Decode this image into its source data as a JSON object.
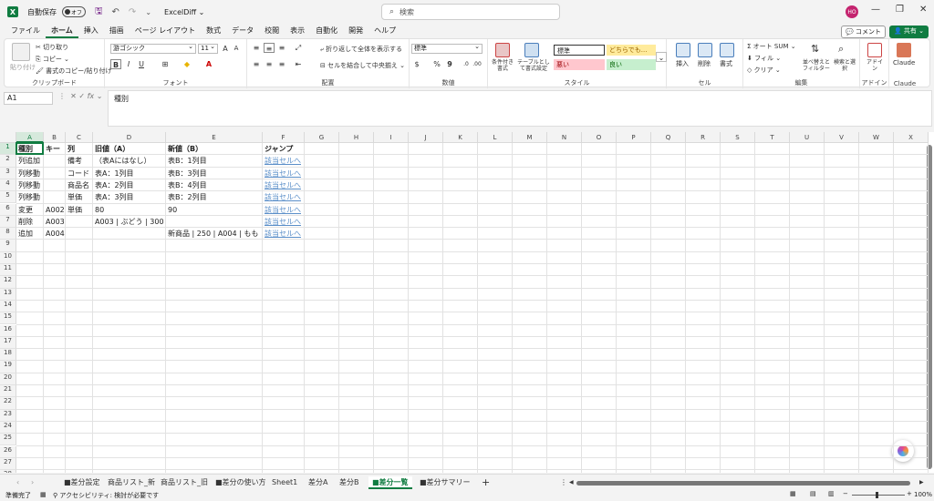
{
  "titlebar": {
    "autosave_label": "自動保存",
    "autosave_state": "オフ",
    "doc_title": "ExcelDiff ⌄",
    "search_placeholder": "検索",
    "avatar_initials": "HO"
  },
  "menu": {
    "tabs": [
      "ファイル",
      "ホーム",
      "挿入",
      "描画",
      "ページ レイアウト",
      "数式",
      "データ",
      "校閲",
      "表示",
      "自動化",
      "開発",
      "ヘルプ"
    ],
    "active": "ホーム",
    "comment": "コメント",
    "share": "共有"
  },
  "ribbon": {
    "clipboard": {
      "label": "クリップボード",
      "paste": "貼り付け",
      "cut": "切り取り",
      "copy": "コピー",
      "format_painter": "書式のコピー/貼り付け"
    },
    "font": {
      "label": "フォント",
      "name": "游ゴシック",
      "size": "11",
      "bold": "B",
      "italic": "I",
      "underline": "U"
    },
    "alignment": {
      "label": "配置",
      "wrap": "折り返して全体を表示する",
      "merge": "セルを結合して中央揃え"
    },
    "number": {
      "label": "数値",
      "format": "標準",
      "currency": "$",
      "percent": "%",
      "comma": "9"
    },
    "styles": {
      "label": "スタイル",
      "conditional": "条件付き書式",
      "table": "テーブルとして書式設定",
      "standard": "標準",
      "neutral": "どちらでも...",
      "bad": "悪い",
      "good": "良い"
    },
    "cells": {
      "label": "セル",
      "insert": "挿入",
      "delete": "削除",
      "format": "書式"
    },
    "editing": {
      "label": "編集",
      "autosum": "オート SUM",
      "fill": "フィル",
      "clear": "クリア",
      "sort": "並べ替えとフィルター",
      "find": "検索と選択"
    },
    "addins": {
      "label": "アドイン",
      "addin": "アドイン"
    },
    "claude": {
      "label": "Claude",
      "button": "Claude"
    }
  },
  "formula_bar": {
    "name_box": "A1",
    "content": "種別"
  },
  "grid": {
    "columns": [
      "A",
      "B",
      "C",
      "D",
      "E",
      "F",
      "G",
      "H",
      "I",
      "J",
      "K",
      "L",
      "M",
      "N",
      "O",
      "P",
      "Q",
      "R",
      "S",
      "T",
      "U",
      "V",
      "W",
      "X"
    ],
    "row_count": 38,
    "rows": [
      [
        "種別",
        "キー",
        "列",
        "旧値（A）",
        "新値（B）",
        "ジャンプ"
      ],
      [
        "列追加",
        "",
        "備考",
        "（表Aにはなし）",
        "表B：1列目",
        "該当セルへ"
      ],
      [
        "列移動",
        "",
        "コード",
        "表A：1列目",
        "表B：3列目",
        "該当セルへ"
      ],
      [
        "列移動",
        "",
        "商品名",
        "表A：2列目",
        "表B：4列目",
        "該当セルへ"
      ],
      [
        "列移動",
        "",
        "単価",
        "表A：3列目",
        "表B：2列目",
        "該当セルへ"
      ],
      [
        "変更",
        "A002",
        "単価",
        "80",
        "90",
        "該当セルへ"
      ],
      [
        "削除",
        "A003",
        "",
        "A003 | ぶどう | 300",
        "",
        "該当セルへ"
      ],
      [
        "追加",
        "A004",
        "",
        "",
        "新商品 | 250 | A004 | もも",
        "該当セルへ"
      ]
    ]
  },
  "sheets": {
    "tabs": [
      "■差分設定",
      "商品リスト_新",
      "商品リスト_旧",
      "■差分の使い方",
      "Sheet1",
      "差分A",
      "差分B",
      "■差分一覧",
      "■差分サマリー"
    ],
    "active": "■差分一覧",
    "add": "+"
  },
  "status": {
    "ready": "準備完了",
    "accessibility": "アクセシビリティ: 検討が必要です",
    "zoom": "100%"
  },
  "colors": {
    "accent": "#107c41",
    "link": "#5b8fc9"
  }
}
